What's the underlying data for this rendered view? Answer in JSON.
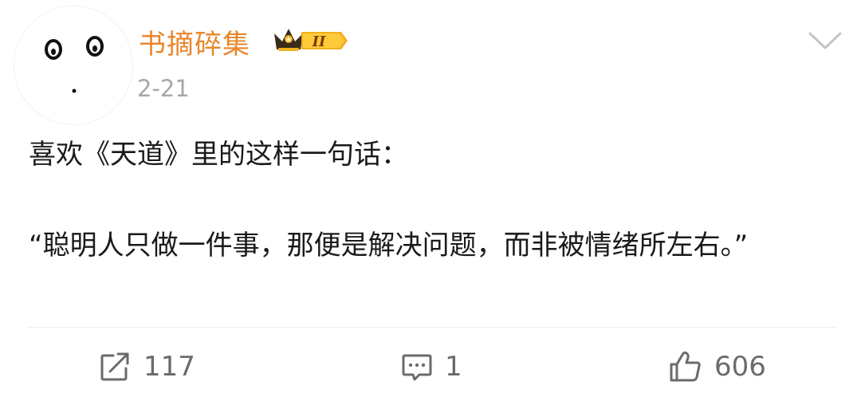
{
  "post": {
    "username": "书摘碎集",
    "vip_level": "II",
    "date": "2-21",
    "text_line1": "喜欢《天道》里的这样一句话：",
    "text_quote": "“聪明人只做一件事，那便是解决问题，而非被情绪所左右。”"
  },
  "icons": {
    "avatar": "avatar-face",
    "badge": "crown-vip-badge",
    "menu": "chevron-down-icon",
    "repost": "repost-icon",
    "comment": "comment-icon",
    "like": "thumbs-up-icon"
  },
  "actions": {
    "repost_count": "117",
    "comment_count": "1",
    "like_count": "606"
  },
  "colors": {
    "username": "#e9862b",
    "badge_gold": "#f2b01e",
    "muted": "#a8a8a8",
    "icon_gray": "#6b6b6b"
  }
}
